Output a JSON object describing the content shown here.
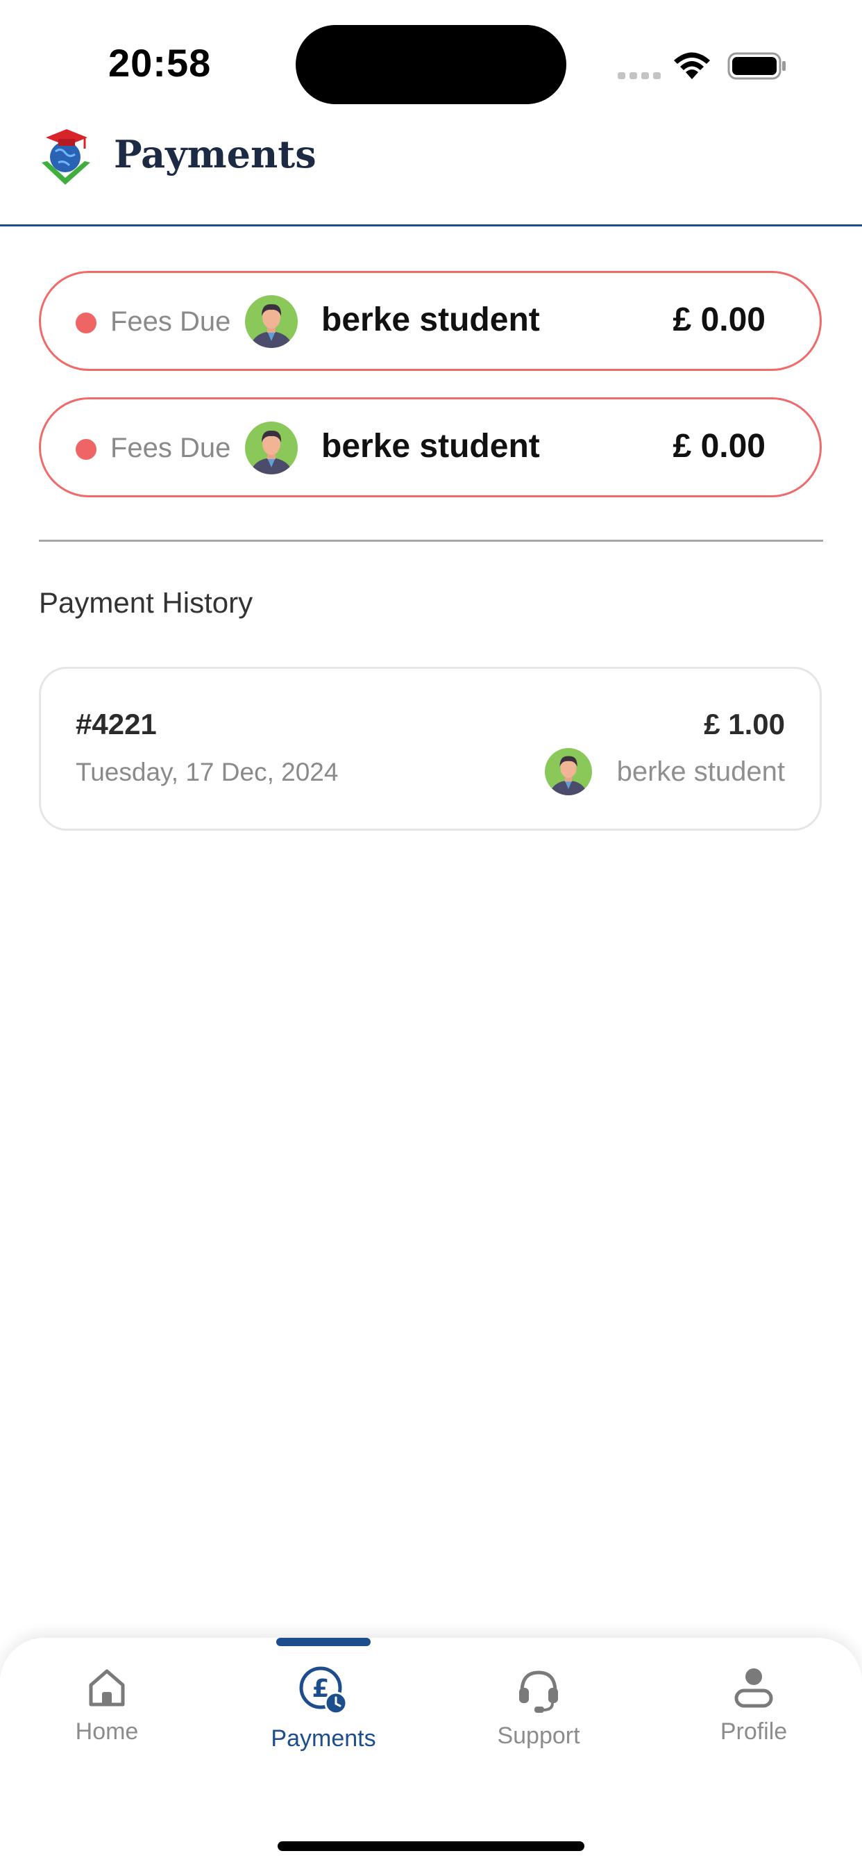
{
  "status_bar": {
    "time": "20:58"
  },
  "header": {
    "title": "Payments",
    "logo_icon": "graduation-globe-logo"
  },
  "fees_due": [
    {
      "status": "Fees Due",
      "student": "berke student",
      "amount": "£ 0.00",
      "status_color": "#ef6464"
    },
    {
      "status": "Fees Due",
      "student": "berke student",
      "amount": "£ 0.00",
      "status_color": "#ef6464"
    }
  ],
  "history": {
    "title": "Payment History",
    "items": [
      {
        "id": "#4221",
        "date": "Tuesday, 17 Dec, 2024",
        "amount": "£ 1.00",
        "student": "berke student"
      }
    ]
  },
  "nav": {
    "items": [
      {
        "label": "Home",
        "icon": "home-icon",
        "active": false
      },
      {
        "label": "Payments",
        "icon": "pound-clock-icon",
        "active": true
      },
      {
        "label": "Support",
        "icon": "headset-icon",
        "active": false
      },
      {
        "label": "Profile",
        "icon": "person-icon",
        "active": false
      }
    ]
  },
  "colors": {
    "accent": "#1c4e8e",
    "due": "#f06a6a"
  }
}
